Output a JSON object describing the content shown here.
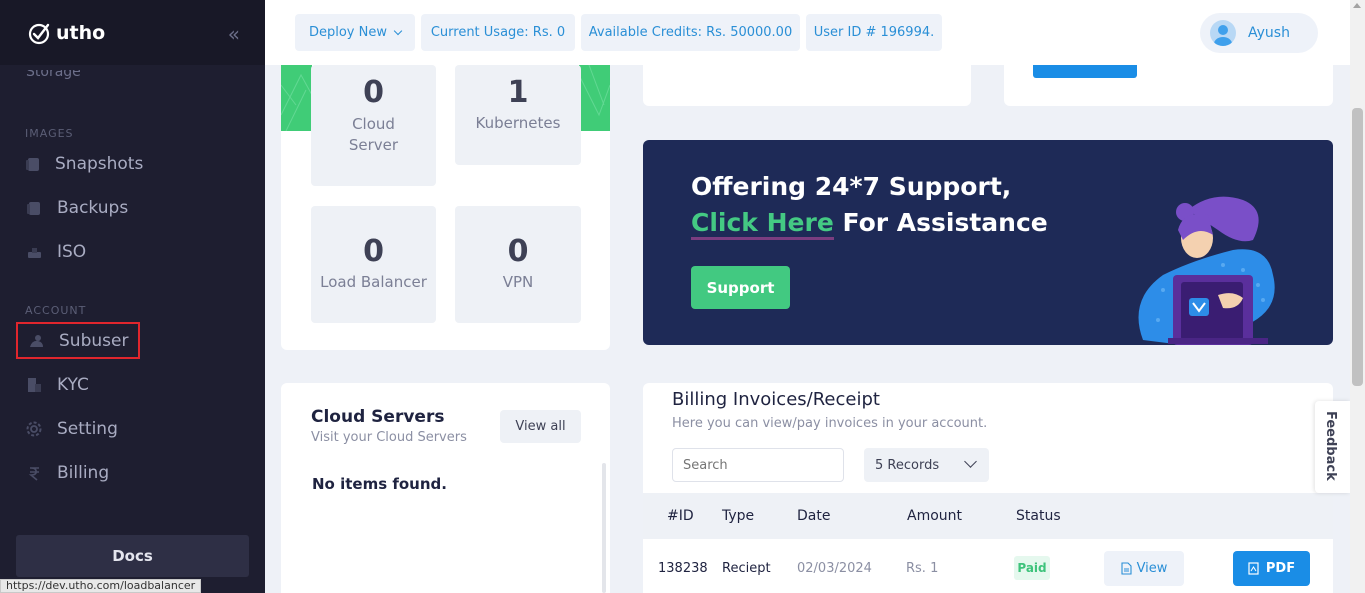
{
  "sidebar": {
    "logo_text": "utho",
    "collapse_icon": "«",
    "partial_item_label": "Storage",
    "section_images": "IMAGES",
    "section_account": "ACCOUNT",
    "items": [
      {
        "label": "Snapshots",
        "icon": "snapshot-icon"
      },
      {
        "label": "Backups",
        "icon": "backup-icon"
      },
      {
        "label": "ISO",
        "icon": "iso-icon"
      },
      {
        "label": "Subuser",
        "icon": "subuser-icon"
      },
      {
        "label": "KYC",
        "icon": "kyc-icon"
      },
      {
        "label": "Setting",
        "icon": "gear-icon"
      },
      {
        "label": "Billing",
        "icon": "rupee-icon"
      }
    ],
    "docs_label": "Docs"
  },
  "status_bar_url": "https://dev.utho.com/loadbalancer",
  "topbar": {
    "deploy_label": "Deploy New",
    "usage": "Current Usage: Rs. 0",
    "credits": "Available Credits: Rs. 50000.00",
    "user_id": "User ID # 196994.",
    "username": "Ayush"
  },
  "resources": [
    {
      "count": "0",
      "label": "Cloud Server"
    },
    {
      "count": "1",
      "label": "Kubernetes"
    },
    {
      "count": "0",
      "label": "Load Balancer"
    },
    {
      "count": "0",
      "label": "VPN"
    }
  ],
  "banner": {
    "line1": "Offering 24*7 Support,",
    "click_here": "Click Here",
    "line2_rest": " For Assistance",
    "button": "Support",
    "colors": {
      "bg": "#1e2a57",
      "accent": "#44c983"
    }
  },
  "cloud_servers": {
    "title": "Cloud Servers",
    "subtitle": "Visit your Cloud Servers",
    "view_all": "View all",
    "empty": "No items found."
  },
  "billing": {
    "title": "Billing Invoices/Receipt",
    "subtitle": "Here you can view/pay invoices in your account.",
    "search_placeholder": "Search",
    "records": "5 Records",
    "columns": [
      "#ID",
      "Type",
      "Date",
      "Amount",
      "Status"
    ],
    "rows": [
      {
        "id": "138238",
        "type": "Reciept",
        "date": "02/03/2024",
        "amount": "Rs. 1",
        "status": "Paid",
        "view": "View",
        "pdf": "PDF"
      }
    ]
  },
  "feedback_label": "Feedback"
}
